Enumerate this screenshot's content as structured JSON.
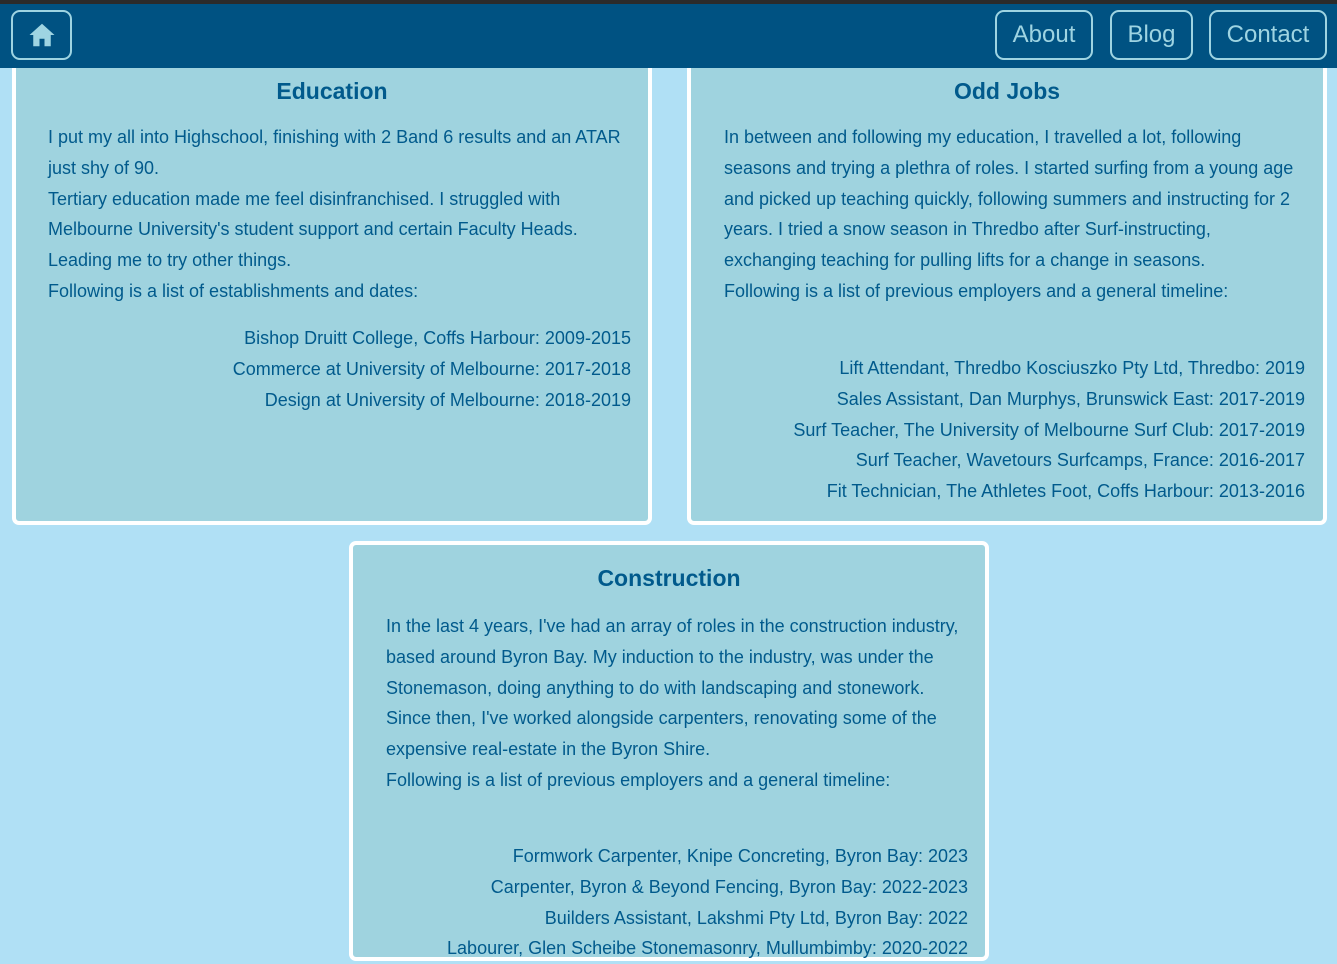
{
  "nav": {
    "home_icon": "home-icon",
    "about_label": "About",
    "blog_label": "Blog",
    "contact_label": "Contact"
  },
  "colors": {
    "page_background": "#b0e0f5",
    "navbar": "#005282",
    "card_background": "#9fd3df",
    "card_border": "#ffffff",
    "text": "#015a8c",
    "nav_accent": "#9ed4e2"
  },
  "education": {
    "title": "Education",
    "paragraphs": [
      "I put my all into Highschool, finishing with 2 Band 6 results and an ATAR just shy of 90.",
      "Tertiary education made me feel disinfranchised. I struggled with Melbourne University's student support and certain Faculty Heads. Leading me to try other things.",
      "Following is a list of establishments and dates:"
    ],
    "items": [
      "Bishop Druitt College, Coffs Harbour: 2009-2015",
      "Commerce at University of Melbourne: 2017-2018",
      "Design at University of Melbourne: 2018-2019"
    ]
  },
  "odd_jobs": {
    "title": "Odd Jobs",
    "paragraphs": [
      "In between and following my education, I travelled a lot, following seasons and trying a plethra of roles. I started surfing from a young age and picked up teaching quickly, following summers and instructing for 2 years. I tried a snow season in Thredbo after Surf-instructing, exchanging teaching for pulling lifts for a change in seasons.",
      "Following is a list of previous employers and a general timeline:"
    ],
    "items": [
      "Lift Attendant, Thredbo Kosciuszko Pty Ltd, Thredbo: 2019",
      "Sales Assistant, Dan Murphys, Brunswick East: 2017-2019",
      "Surf Teacher, The University of Melbourne Surf Club: 2017-2019",
      "Surf Teacher, Wavetours Surfcamps, France: 2016-2017",
      "Fit Technician, The Athletes Foot, Coffs Harbour: 2013-2016"
    ]
  },
  "construction": {
    "title": "Construction",
    "paragraphs": [
      "In the last 4 years, I've had an array of roles in the construction industry, based around Byron Bay. My induction to the industry, was under the Stonemason, doing anything to do with landscaping and stonework.",
      "Since then, I've worked alongside carpenters, renovating some of the expensive real-estate in the Byron Shire.",
      "Following is a list of previous employers and a general timeline:"
    ],
    "items": [
      "Formwork Carpenter, Knipe Concreting, Byron Bay: 2023",
      "Carpenter, Byron & Beyond Fencing, Byron Bay: 2022-2023",
      "Builders Assistant, Lakshmi Pty Ltd, Byron Bay: 2022",
      "Labourer, Glen Scheibe Stonemasonry, Mullumbimby: 2020-2022"
    ]
  }
}
